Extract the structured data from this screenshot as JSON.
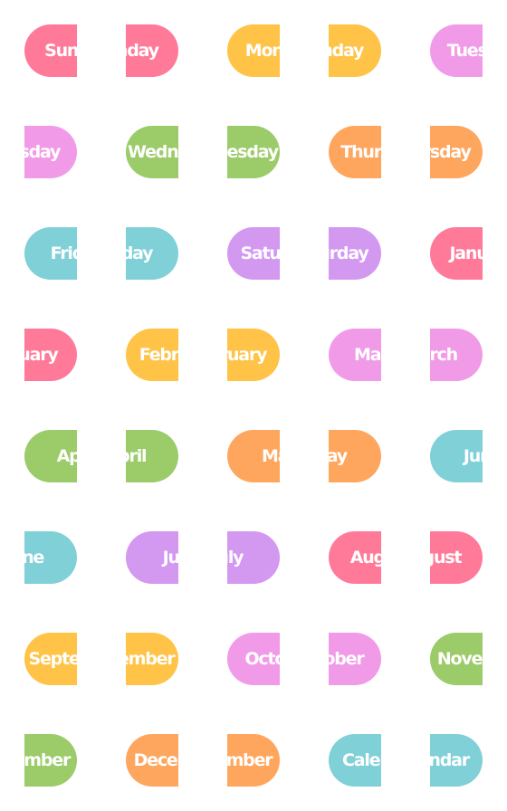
{
  "colors": {
    "pink": "#ff7a98",
    "yellow": "#ffc347",
    "violet": "#f19be8",
    "green": "#9ccb69",
    "orange": "#ffa65e",
    "cyan": "#80d0d8",
    "purple": "#d398f0"
  },
  "labels": [
    {
      "text": "Sunday",
      "color": "pink"
    },
    {
      "text": "Monday",
      "color": "yellow"
    },
    {
      "text": "Tuesday",
      "color": "violet"
    },
    {
      "text": "Wednesday",
      "color": "green"
    },
    {
      "text": "Thursday",
      "color": "orange"
    },
    {
      "text": "Friday",
      "color": "cyan"
    },
    {
      "text": "Saturday",
      "color": "purple"
    },
    {
      "text": "January",
      "color": "pink"
    },
    {
      "text": "February",
      "color": "yellow"
    },
    {
      "text": "March",
      "color": "violet"
    },
    {
      "text": "April",
      "color": "green"
    },
    {
      "text": "May",
      "color": "orange"
    },
    {
      "text": "June",
      "color": "cyan"
    },
    {
      "text": "July",
      "color": "purple"
    },
    {
      "text": "August",
      "color": "pink"
    },
    {
      "text": "September",
      "color": "yellow"
    },
    {
      "text": "October",
      "color": "violet"
    },
    {
      "text": "November",
      "color": "green"
    },
    {
      "text": "December",
      "color": "orange"
    },
    {
      "text": "Calendar",
      "color": "cyan"
    }
  ]
}
